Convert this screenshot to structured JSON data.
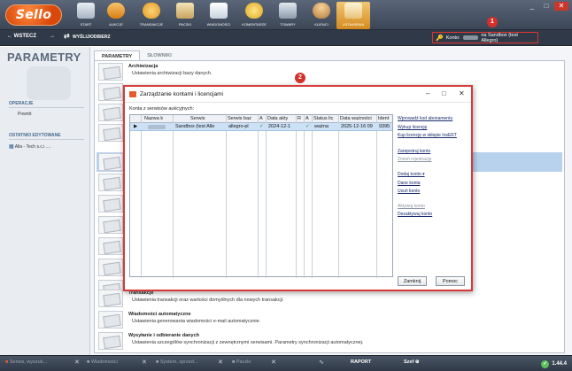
{
  "app": {
    "logo_text": "Sello",
    "toolbar": [
      {
        "name": "start",
        "label": "START",
        "icon": "home-icon",
        "color": "#c9d3df"
      },
      {
        "name": "aukcje",
        "label": "AUKCJE",
        "icon": "auction-icon",
        "color": "#f0a734"
      },
      {
        "name": "transakcje",
        "label": "TRANSAKCJE",
        "icon": "transaction-icon",
        "color": "#f2b23f"
      },
      {
        "name": "paczki",
        "label": "PACZKI",
        "icon": "package-icon",
        "color": "#e0c58a"
      },
      {
        "name": "wiadomosci",
        "label": "WIADOMOŚCI",
        "icon": "message-icon",
        "color": "#d9e2ea"
      },
      {
        "name": "komentarze",
        "label": "KOMENTARZE",
        "icon": "comment-icon",
        "color": "#f3c13a"
      },
      {
        "name": "towary",
        "label": "TOWARY",
        "icon": "goods-icon",
        "color": "#b9c6d4"
      },
      {
        "name": "klienci",
        "label": "KLIENCI",
        "icon": "clients-icon",
        "color": "#e9b770"
      },
      {
        "name": "ustawienia",
        "label": "USTAWIENIA",
        "icon": "settings-icon",
        "color": "#f7e2b0"
      }
    ]
  },
  "window": {
    "minimize": "_",
    "maximize": "□",
    "close": "✕"
  },
  "nav": {
    "back": "← WSTECZ",
    "forward": "→",
    "sync": "WYŚLIJ/ODBIERZ",
    "account_label": "Konto:",
    "account_value": "na Sandbox (test Allegro)",
    "marker1": "1",
    "marker2": "2"
  },
  "left": {
    "title": "PARAMETRY",
    "section_ops": "OPERACJE",
    "op_back": "Powrót",
    "section_recent": "OSTATNIO EDYTOWANE",
    "recent_item": "Alla - Tech s.c.i ...."
  },
  "main": {
    "tab_params": "PARAMETRY",
    "tab_dicts": "SŁOWNIKI",
    "rows_top": [
      {
        "title": "Archiwizacja",
        "desc": "Ustawienia archiwizacji bazy danych."
      }
    ],
    "rows_bottom": [
      {
        "title": "Transakcje",
        "desc": "Ustawienia transakcji oraz wartości domyślnych dla nowych transakcji."
      },
      {
        "title": "Wiadomości automatyczne",
        "desc": "Ustawienia generowania wiadomości e-mail automatycznie."
      },
      {
        "title": "Wysyłanie i odbieranie danych",
        "desc": "Ustawienia szczegółów synchronizacji z zewnętrznymi serwisami. Parametry synchronizacji automatycznej."
      }
    ]
  },
  "dialog": {
    "title": "Zarządzanie kontami i licencjami",
    "label": "Konta z serwisów aukcyjnych:",
    "columns": [
      "Nazwa k",
      "Serwis",
      "Serwis baz",
      "A",
      "Data akty",
      "R",
      "A",
      "Status lic",
      "Data ważności",
      "Ident"
    ],
    "row": {
      "marker": "▶",
      "serwis": "Sandbox (test Alle",
      "serwis_baz": "allegro-pl",
      "a1": "✓",
      "data_akty": "2024-12-1",
      "r": "",
      "a2": "✓",
      "status": "ważna",
      "data_waznosci": "2025-12-16 09",
      "ident": "9395"
    },
    "links": [
      {
        "label": "Wprowadź kod abonamentu",
        "enabled": true
      },
      {
        "label": "Wykup licencję",
        "enabled": true
      },
      {
        "label": "Kup licencję w sklepie InsERT",
        "enabled": true
      },
      {
        "label": "Zarejestruj konto",
        "enabled": true
      },
      {
        "label": "Zmień rejestrację",
        "enabled": false
      },
      {
        "label": "Dodaj konto ▾",
        "enabled": true
      },
      {
        "label": "Dane konta",
        "enabled": true
      },
      {
        "label": "Usuń konto",
        "enabled": true
      },
      {
        "label": "Aktywuj konto",
        "enabled": false
      },
      {
        "label": "Dezaktywuj konto",
        "enabled": true
      }
    ],
    "btn_close": "Zamknij",
    "btn_help": "Pomoc"
  },
  "statusbar": {
    "items": [
      "Serwis, wyszuk...",
      "Wiadomości",
      "System, sprzed...",
      "Paczki"
    ],
    "raport": "RAPORT",
    "user": "Szef ⊕",
    "version": "1.44.4"
  }
}
